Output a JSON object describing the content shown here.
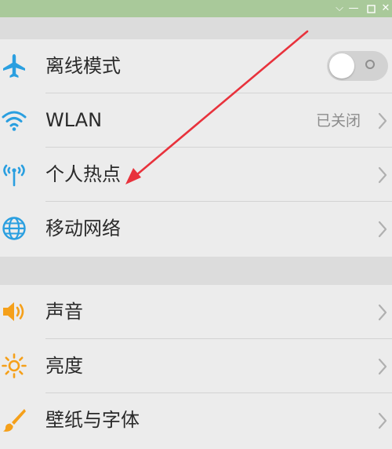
{
  "window": {
    "controls": [
      "chevron-down-icon",
      "minimize-icon",
      "maximize-icon",
      "close-icon"
    ]
  },
  "colors": {
    "titlebar": "#a9c99a",
    "icon_blue": "#2a9fe0",
    "icon_orange": "#f5a01a",
    "annotation_arrow": "#e8323c"
  },
  "groups": [
    {
      "items": [
        {
          "label": "离线模式",
          "icon": "airplane-icon",
          "control": "toggle",
          "toggle_on": false
        },
        {
          "label": "WLAN",
          "icon": "wifi-icon",
          "status": "已关闭",
          "control": "chevron"
        },
        {
          "label": "个人热点",
          "icon": "hotspot-icon",
          "control": "chevron"
        },
        {
          "label": "移动网络",
          "icon": "globe-icon",
          "control": "chevron"
        }
      ]
    },
    {
      "items": [
        {
          "label": "声音",
          "icon": "speaker-icon",
          "control": "chevron"
        },
        {
          "label": "亮度",
          "icon": "sun-icon",
          "control": "chevron"
        },
        {
          "label": "壁纸与字体",
          "icon": "brush-icon",
          "control": "chevron"
        }
      ]
    }
  ]
}
